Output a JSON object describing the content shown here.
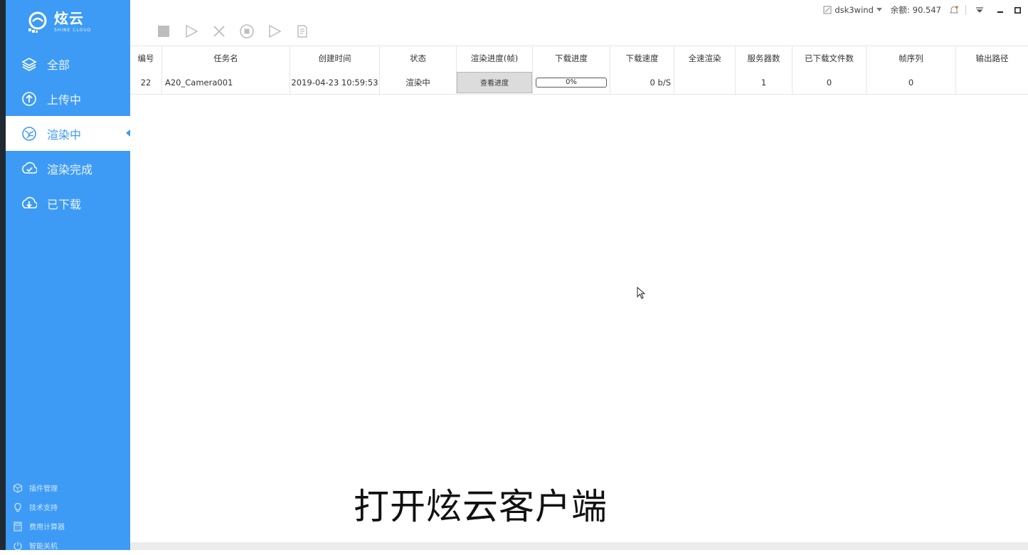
{
  "app": {
    "logo_text": "炫云",
    "logo_sub": "SHINE CLOUD"
  },
  "sidebar": {
    "items": [
      {
        "label": "全部",
        "icon": "layers-icon"
      },
      {
        "label": "上传中",
        "icon": "upload-icon"
      },
      {
        "label": "渲染中",
        "icon": "render-icon",
        "active": true
      },
      {
        "label": "渲染完成",
        "icon": "check-cloud-icon"
      },
      {
        "label": "已下载",
        "icon": "download-icon"
      }
    ],
    "bottom_links": [
      {
        "label": "插件管理",
        "icon": "plugin-icon"
      },
      {
        "label": "技术支持",
        "icon": "lightbulb-icon"
      },
      {
        "label": "费用计算器",
        "icon": "calculator-icon"
      },
      {
        "label": "智能关机",
        "icon": "power-icon"
      }
    ]
  },
  "toolbar": {
    "tools": [
      "stop-icon",
      "play-icon",
      "delete-icon",
      "record-icon",
      "resume-icon",
      "document-icon"
    ]
  },
  "userbar": {
    "username": "dsk3wind",
    "balance_label": "余额:",
    "balance_value": "90.547"
  },
  "table": {
    "columns": [
      "编号",
      "任务名",
      "创建时间",
      "状态",
      "渲染进度(帧)",
      "下载进度",
      "下载速度",
      "全速渲染",
      "服务器数",
      "已下载文件数",
      "帧序列",
      "输出路径"
    ],
    "rows": [
      {
        "id": "22",
        "name": "A20_Camera001",
        "created": "2019-04-23 10:59:53",
        "status": "渲染中",
        "render_progress_button": "查看进度",
        "download_progress": "0%",
        "download_progress_value": 0,
        "download_speed": "0 b/S",
        "full_speed": "",
        "servers": "1",
        "downloaded_files": "0",
        "frame_sequence": "0",
        "output_path": ""
      }
    ]
  },
  "caption": "打开炫云客户端",
  "colors": {
    "sidebar": "#3d9bf5",
    "accent": "#3d9bf5"
  }
}
